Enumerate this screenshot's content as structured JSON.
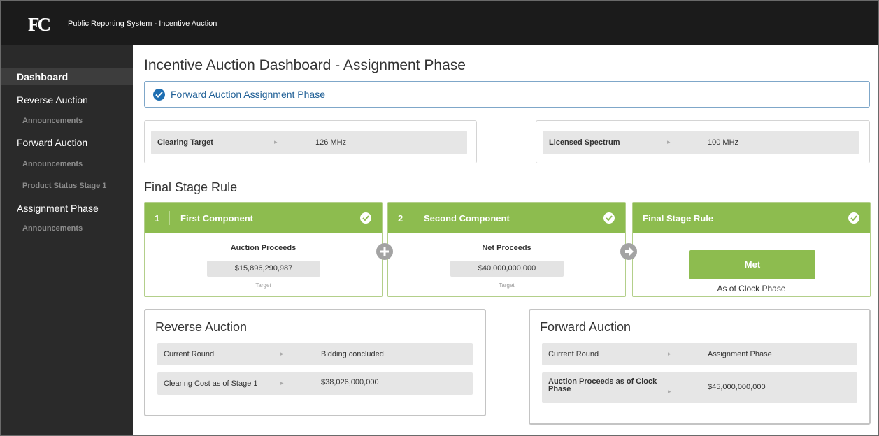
{
  "app": {
    "logo": "FC",
    "title": "Public Reporting System - Incentive Auction"
  },
  "sidebar": {
    "dashboard": "Dashboard",
    "reverse_auction": "Reverse Auction",
    "reverse_announcements": "Announcements",
    "forward_auction": "Forward Auction",
    "forward_announcements": "Announcements",
    "product_status": "Product Status Stage 1",
    "assignment_phase": "Assignment Phase",
    "assignment_announcements": "Announcements"
  },
  "main": {
    "title": "Incentive Auction Dashboard - Assignment Phase",
    "phase_banner": "Forward Auction Assignment Phase",
    "clearing_target": {
      "label": "Clearing Target",
      "value": "126 MHz"
    },
    "licensed_spectrum": {
      "label": "Licensed Spectrum",
      "value": "100 MHz"
    },
    "final_stage_heading": "Final Stage Rule",
    "first_component": {
      "number": "1",
      "title": "First Component",
      "label": "Auction Proceeds",
      "value": "$15,896,290,987",
      "sub": "Target"
    },
    "second_component": {
      "number": "2",
      "title": "Second Component",
      "label": "Net Proceeds",
      "value": "$40,000,000,000",
      "sub": "Target"
    },
    "final_stage_rule": {
      "title": "Final Stage Rule",
      "status": "Met",
      "sub": "As of Clock Phase"
    },
    "reverse_auction": {
      "title": "Reverse Auction",
      "current_round_label": "Current Round",
      "current_round_value": "Bidding concluded",
      "clearing_cost_label": "Clearing Cost as of Stage 1",
      "clearing_cost_value": "$38,026,000,000"
    },
    "forward_auction": {
      "title": "Forward Auction",
      "current_round_label": "Current Round",
      "current_round_value": "Assignment Phase",
      "proceeds_label": "Auction Proceeds as of Clock Phase",
      "proceeds_value": "$45,000,000,000"
    }
  },
  "colors": {
    "accent_green": "#8dbc4f",
    "accent_blue": "#1f6fb2",
    "sidebar_bg": "#2a2a2a",
    "topbar_bg": "#1b1b1b"
  },
  "icons": {
    "check": "check-circle-icon",
    "plus": "plus-circle-icon",
    "arrow": "arrow-right-circle-icon",
    "caret": "caret-right-icon"
  }
}
